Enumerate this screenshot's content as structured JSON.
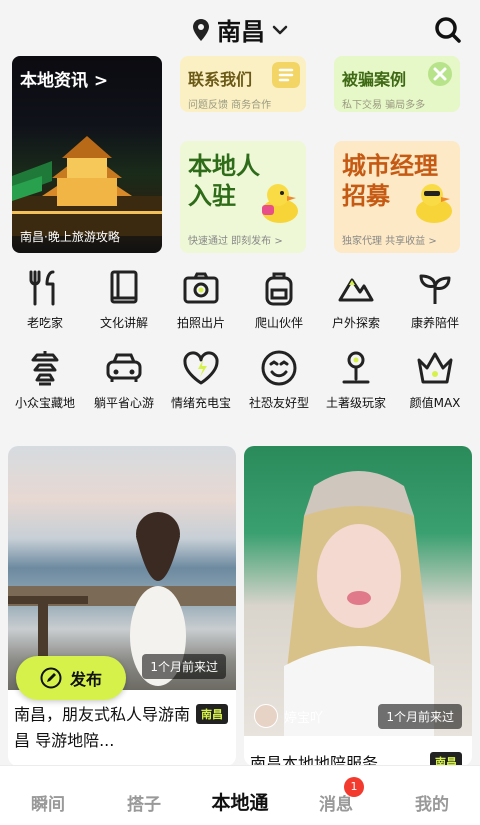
{
  "header": {
    "city": "南昌",
    "pin_icon": "location-pin-icon",
    "chevron_icon": "chevron-down-icon",
    "search_icon": "search-icon"
  },
  "news": {
    "title": "本地资讯 >",
    "caption": "南昌·晚上旅游攻略"
  },
  "mini_cards": {
    "contact": {
      "title": "联系我们",
      "sub": "问题反馈 商务合作",
      "icon": "document-icon"
    },
    "fraud": {
      "title": "被骗案例",
      "sub": "私下交易 骗局多多",
      "icon": "close-icon"
    }
  },
  "big_cards": {
    "resident": {
      "line1": "本地人",
      "line2": "入驻",
      "sub": "快速通过 即刻发布 >"
    },
    "manager": {
      "line1": "城市经理",
      "line2": "招募",
      "sub": "独家代理 共享收益 >"
    }
  },
  "categories": [
    {
      "label": "老吃家",
      "icon": "fork-knife-icon"
    },
    {
      "label": "文化讲解",
      "icon": "book-icon"
    },
    {
      "label": "拍照出片",
      "icon": "camera-icon"
    },
    {
      "label": "爬山伙伴",
      "icon": "backpack-icon"
    },
    {
      "label": "户外探索",
      "icon": "mountain-icon"
    },
    {
      "label": "康养陪伴",
      "icon": "sprout-icon"
    },
    {
      "label": "小众宝藏地",
      "icon": "pagoda-icon"
    },
    {
      "label": "躺平省心游",
      "icon": "car-icon"
    },
    {
      "label": "情绪充电宝",
      "icon": "heart-bolt-icon"
    },
    {
      "label": "社恐友好型",
      "icon": "smile-face-icon"
    },
    {
      "label": "土著级玩家",
      "icon": "map-pin-icon"
    },
    {
      "label": "颜值MAX",
      "icon": "crown-icon"
    }
  ],
  "feed": [
    {
      "time": "1个月前来过",
      "title": "南昌，朋友式私人导游南昌 导游地陪...",
      "tag": "南昌"
    },
    {
      "time": "1个月前来过",
      "author": "婷宝吖",
      "title": "南昌本地地陪服务",
      "tag": "南昌"
    }
  ],
  "publish": {
    "label": "发布",
    "icon": "pen-icon"
  },
  "nav": {
    "items": [
      "瞬间",
      "搭子",
      "本地通",
      "消息",
      "我的"
    ],
    "active": "本地通",
    "badge": "1"
  },
  "colors": {
    "accent": "#d6f24a",
    "badge": "#f23a2f"
  }
}
